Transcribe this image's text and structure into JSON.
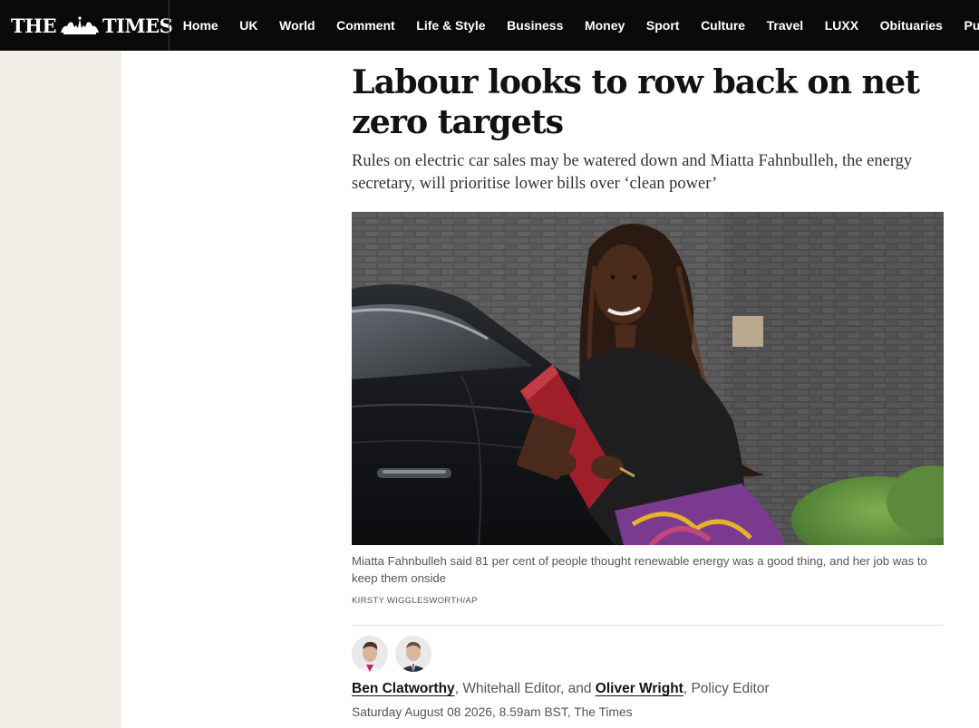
{
  "header": {
    "logo": {
      "left": "THE",
      "right": "TIMES",
      "crest_icon": "royal-crest-icon"
    },
    "nav_items": [
      {
        "label": "Home"
      },
      {
        "label": "UK"
      },
      {
        "label": "World"
      },
      {
        "label": "Comment"
      },
      {
        "label": "Life & Style"
      },
      {
        "label": "Business"
      },
      {
        "label": "Money"
      },
      {
        "label": "Sport"
      },
      {
        "label": "Culture"
      },
      {
        "label": "Travel"
      },
      {
        "label": "LUXX"
      },
      {
        "label": "Obituaries"
      },
      {
        "label": "Puzzles"
      }
    ]
  },
  "article": {
    "headline": "Labour looks to row back on net zero targets",
    "standfirst": "Rules on electric car sales may be watered down and Miatta Fahnbulleh, the energy secretary, will prioritise lower bills over ‘clean power’",
    "image": {
      "alt": "Miatta Fahnbulleh holding a red ministerial folder beside a black car"
    },
    "caption": "Miatta Fahnbulleh said 81 per cent of people thought renewable energy was a good thing, and her job was to keep them onside",
    "credit": "KIRSTY WIGGLESWORTH/AP",
    "authors": [
      {
        "name": "Ben Clatworthy",
        "role": "Whitehall Editor",
        "avatar_icon": "author-avatar"
      },
      {
        "name": "Oliver Wright",
        "role": "Policy Editor",
        "avatar_icon": "author-avatar"
      }
    ],
    "byline_separator_1": ", ",
    "byline_joiner": ", and ",
    "byline_separator_2": ", ",
    "dateline": "Saturday August 08 2026, 8.59am BST, The Times"
  },
  "colors": {
    "header_bg": "#0a0a0a",
    "header_text": "#ffffff",
    "side_gutter": "#f2efe9",
    "headline": "#121212",
    "body_text": "#333333",
    "meta_text": "#555555",
    "divider": "#e2e2e2"
  }
}
